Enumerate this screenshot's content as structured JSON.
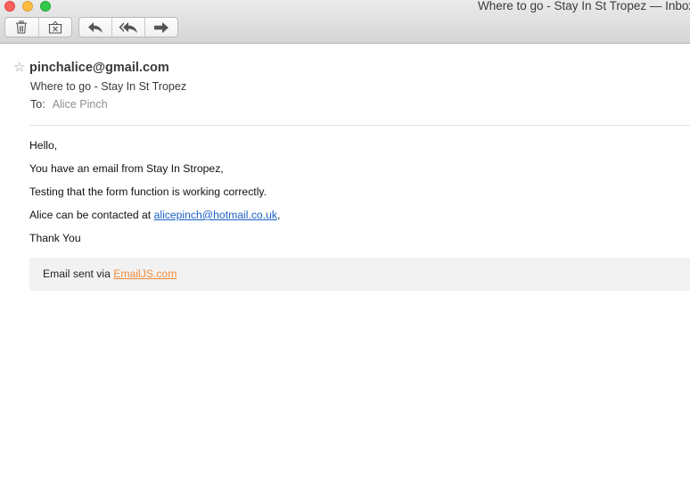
{
  "window": {
    "title": "Where to go - Stay In St Tropez — Inbox"
  },
  "toolbar": {
    "delete_icon": "trash-icon",
    "junk_icon": "junk-icon",
    "reply_icon": "reply-icon",
    "reply_all_icon": "reply-all-icon",
    "forward_icon": "forward-icon"
  },
  "message": {
    "from": "pinchalice@gmail.com",
    "subject": "Where to go - Stay In St Tropez",
    "to_label": "To:",
    "to_name": "Alice Pinch",
    "body": {
      "greeting": "Hello,",
      "line1": "You have an email from Stay In Stropez,",
      "line2": "Testing that the form function is working correctly.",
      "contact_prefix": "Alice can be contacted at ",
      "contact_email": "alicepinch@hotmail.co.uk",
      "contact_suffix": ",",
      "signoff": "Thank You"
    },
    "footer": {
      "prefix": "Email sent via ",
      "link": "EmailJS.com"
    }
  },
  "colors": {
    "link_blue": "#1a5fc8",
    "link_orange": "#f08a3a",
    "traffic_close": "#fc605c",
    "traffic_min": "#fdbc40",
    "traffic_zoom": "#34c84a"
  }
}
